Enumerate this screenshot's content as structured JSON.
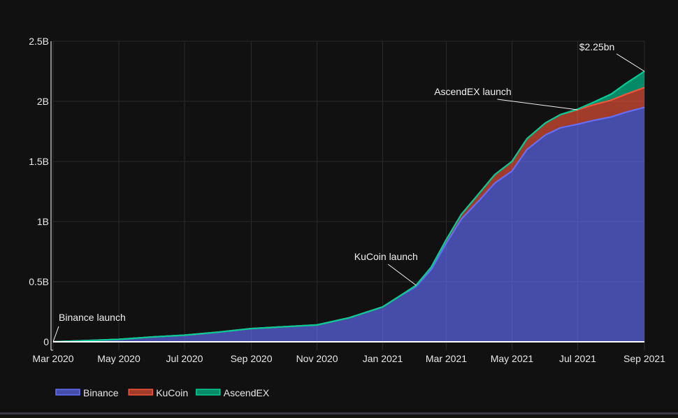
{
  "chart_data": {
    "type": "area",
    "stacked": true,
    "x_dates": [
      "2020-03-01",
      "2020-04-01",
      "2020-05-01",
      "2020-06-01",
      "2020-07-01",
      "2020-08-01",
      "2020-09-01",
      "2020-10-01",
      "2020-11-01",
      "2020-12-01",
      "2021-01-01",
      "2021-01-15",
      "2021-02-01",
      "2021-02-15",
      "2021-03-01",
      "2021-03-15",
      "2021-04-01",
      "2021-04-15",
      "2021-05-01",
      "2021-05-15",
      "2021-06-01",
      "2021-06-15",
      "2021-07-01",
      "2021-07-15",
      "2021-08-01",
      "2021-08-15",
      "2021-09-01"
    ],
    "series": [
      {
        "name": "Binance",
        "color": "#636efa",
        "values": [
          0.0,
          0.01,
          0.02,
          0.04,
          0.055,
          0.08,
          0.11,
          0.125,
          0.14,
          0.2,
          0.29,
          0.37,
          0.46,
          0.6,
          0.82,
          1.02,
          1.18,
          1.32,
          1.42,
          1.6,
          1.72,
          1.78,
          1.81,
          1.84,
          1.87,
          1.91,
          1.95
        ]
      },
      {
        "name": "KuCoin",
        "color": "#ef553b",
        "values": [
          0,
          0,
          0,
          0,
          0,
          0,
          0,
          0,
          0,
          0,
          0,
          0,
          0.01,
          0.02,
          0.03,
          0.04,
          0.06,
          0.07,
          0.08,
          0.09,
          0.1,
          0.11,
          0.12,
          0.13,
          0.14,
          0.15,
          0.165
        ]
      },
      {
        "name": "AscendEX",
        "color": "#00cc96",
        "values": [
          0,
          0,
          0,
          0,
          0,
          0,
          0,
          0,
          0,
          0,
          0,
          0,
          0,
          0,
          0,
          0,
          0,
          0,
          0,
          0,
          0,
          0,
          0.005,
          0.02,
          0.05,
          0.09,
          0.135
        ]
      }
    ],
    "x_ticks": [
      {
        "date": "2020-03-01",
        "label": "Mar 2020"
      },
      {
        "date": "2020-05-01",
        "label": "May 2020"
      },
      {
        "date": "2020-07-01",
        "label": "Jul 2020"
      },
      {
        "date": "2020-09-01",
        "label": "Sep 2020"
      },
      {
        "date": "2020-11-01",
        "label": "Nov 2020"
      },
      {
        "date": "2021-01-01",
        "label": "Jan 2021"
      },
      {
        "date": "2021-03-01",
        "label": "Mar 2021"
      },
      {
        "date": "2021-05-01",
        "label": "May 2021"
      },
      {
        "date": "2021-07-01",
        "label": "Jul 2021"
      },
      {
        "date": "2021-09-01",
        "label": "Sep 2021"
      }
    ],
    "y_ticks": [
      {
        "value": 0,
        "label": "0"
      },
      {
        "value": 0.5,
        "label": "0.5B"
      },
      {
        "value": 1,
        "label": "1B"
      },
      {
        "value": 1.5,
        "label": "1.5B"
      },
      {
        "value": 2,
        "label": "2B"
      },
      {
        "value": 2.5,
        "label": "2.5B"
      }
    ],
    "ylim": [
      -0.07,
      2.5
    ],
    "xlim": [
      "2020-03-01",
      "2021-09-01"
    ],
    "grid": true,
    "legend_position": "bottom-left",
    "annotations": [
      {
        "text": "Binance launch",
        "date": "2020-03-01",
        "value": 0.0
      },
      {
        "text": "KuCoin launch",
        "date": "2021-02-01",
        "value": 0.47
      },
      {
        "text": "AscendEX launch",
        "date": "2021-07-01",
        "value": 1.93
      },
      {
        "text": "$2.25bn",
        "date": "2021-09-01",
        "value": 2.25
      }
    ]
  }
}
